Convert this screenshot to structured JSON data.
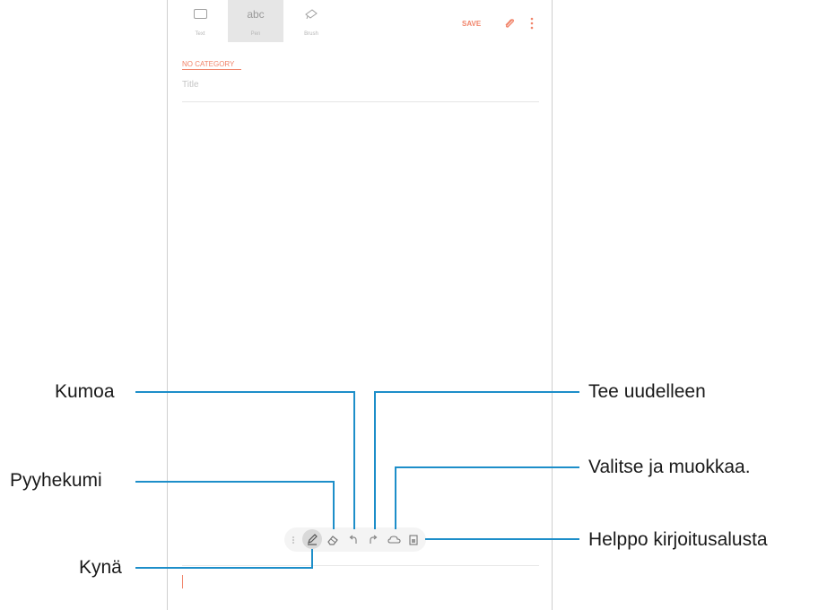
{
  "toolbar": {
    "tabs": [
      {
        "label": "Text",
        "icon": "keyboard-icon",
        "selected": false
      },
      {
        "label": "Pen",
        "icon_text": "abc",
        "selected": true
      },
      {
        "label": "Brush",
        "icon": "brush-icon",
        "selected": false
      }
    ],
    "save_label": "SAVE",
    "accent_color": "#f1846a"
  },
  "note": {
    "category": "NO CATEGORY",
    "title_placeholder": "Title"
  },
  "pen_toolbar": {
    "items": [
      "pen-icon",
      "eraser-icon",
      "undo-icon",
      "redo-icon",
      "selection-icon",
      "easy-writing-pad-icon"
    ],
    "active": "pen-icon"
  },
  "callouts": {
    "undo": "Kumoa",
    "eraser": "Pyyhekumi",
    "pen": "Kynä",
    "redo": "Tee uudelleen",
    "select": "Valitse ja muokkaa.",
    "easy_pad": "Helppo kirjoitusalusta"
  },
  "callout_line_color": "#1d8ec9"
}
